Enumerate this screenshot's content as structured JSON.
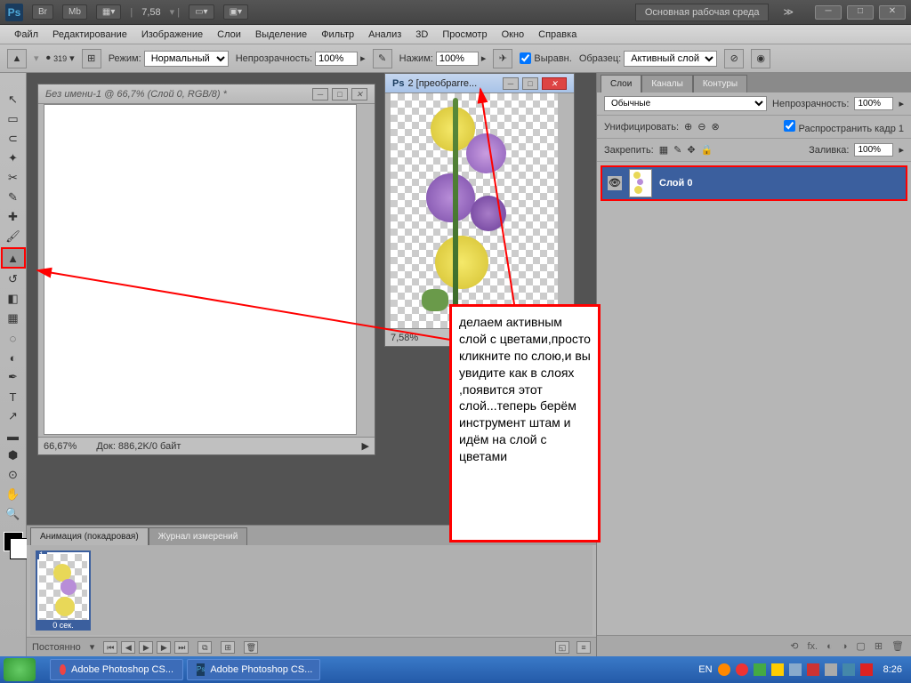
{
  "topbar": {
    "zoom": "7,58",
    "workspace": "Основная рабочая среда"
  },
  "menu": [
    "Файл",
    "Редактирование",
    "Изображение",
    "Слои",
    "Выделение",
    "Фильтр",
    "Анализ",
    "3D",
    "Просмотр",
    "Окно",
    "Справка"
  ],
  "options": {
    "brush_size": "319",
    "mode_label": "Режим:",
    "mode_value": "Нормальный",
    "opacity_label": "Непрозрачность:",
    "opacity_value": "100%",
    "flow_label": "Нажим:",
    "flow_value": "100%",
    "aligned_label": "Выравн.",
    "sample_label": "Образец:",
    "sample_value": "Активный слой"
  },
  "doc1": {
    "title": "Без имени-1 @ 66,7% (Слой 0, RGB/8) *",
    "zoom": "66,67%",
    "info": "Док: 886,2K/0 байт"
  },
  "doc2": {
    "title": "2 [преобрarre...",
    "zoom": "7,58%"
  },
  "note_text": "делаем активным слой с цветами,просто кликните по слою,и вы увидите как в слоях ,появится этот слой...теперь берём инструмент штам и идём на слой с цветами",
  "layers": {
    "tabs": [
      "Слои",
      "Каналы",
      "Контуры"
    ],
    "blend": "Обычные",
    "opacity_label": "Непрозрачность:",
    "opacity": "100%",
    "unify_label": "Унифицировать:",
    "propagate": "Распространить кадр 1",
    "lock_label": "Закрепить:",
    "fill_label": "Заливка:",
    "fill": "100%",
    "layer0": "Слой 0"
  },
  "anim": {
    "tabs": [
      "Анимация (покадровая)",
      "Журнал измерений"
    ],
    "frame_num": "1",
    "frame_dur": "0 сек.",
    "loop": "Постоянно"
  },
  "taskbar": {
    "app1": "Adobe Photoshop CS...",
    "app2": "Adobe Photoshop CS...",
    "lang": "EN",
    "time": "8:26"
  }
}
